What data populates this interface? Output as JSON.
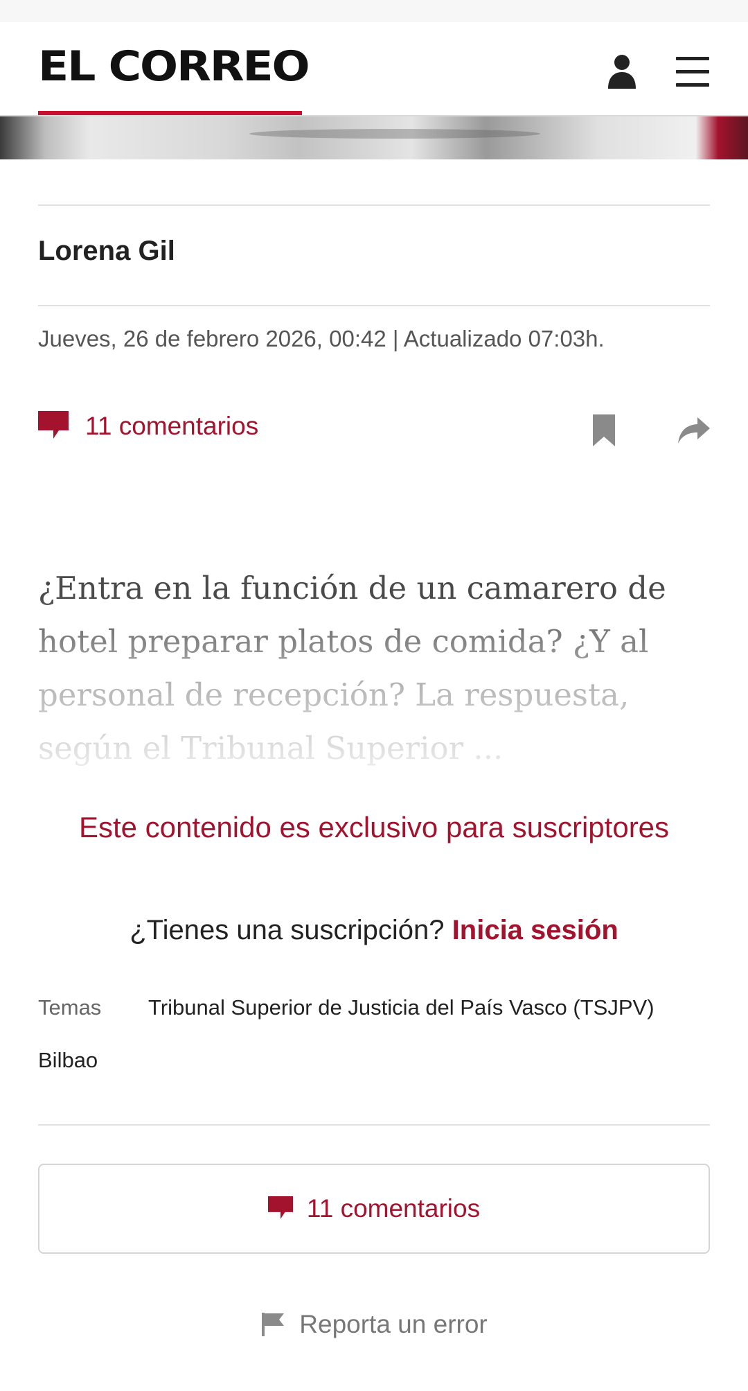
{
  "header": {
    "logo": "EL CORREO",
    "user_icon": "user-icon",
    "menu_icon": "hamburger-menu-icon"
  },
  "article": {
    "author": "Lorena Gil",
    "dateline": "Jueves, 26 de febrero 2026, 00:42 | Actualizado 07:03h.",
    "comments_label": "11 comentarios",
    "lede": "¿Entra en la función de un camarero de hotel preparar platos de comida? ¿Y al personal de recepción? La respuesta, según el Tribunal Superior ..."
  },
  "paywall": {
    "exclusive_text": "Este contenido es exclusivo para suscriptores",
    "question": "¿Tienes una suscripción?",
    "login_link": "Inicia sesión"
  },
  "topics": {
    "label": "Temas",
    "tags": [
      "Tribunal Superior de Justicia del País Vasco (TSJPV)",
      "Bilbao"
    ]
  },
  "footer": {
    "comments_button": "11 comentarios",
    "report_error": "Reporta un error"
  },
  "colors": {
    "accent": "#a3132e",
    "logo_underline": "#c8102e"
  }
}
